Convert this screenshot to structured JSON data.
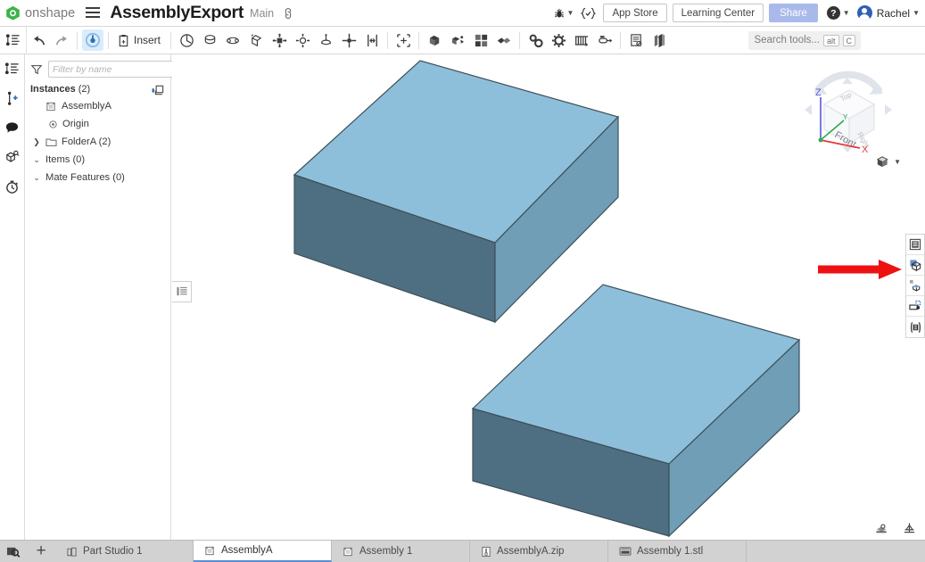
{
  "header": {
    "logo_text": "onshape",
    "logo_icon": "onshape-logo-icon",
    "menu_icon": "hamburger-menu-icon",
    "document_title": "AssemblyExport",
    "branch": "Main",
    "link_icon": "link-icon",
    "bug_icon": "bug-icon",
    "version_icon": "versions-braces-icon",
    "app_store_label": "App Store",
    "learning_center_label": "Learning Center",
    "share_label": "Share",
    "help_label": "?",
    "user_name": "Rachel"
  },
  "toolbar": {
    "tree_toggle_icon": "feature-list-icon",
    "undo_icon": "undo-arrow-icon",
    "redo_icon": "redo-arrow-icon",
    "assemble_icon": "assemble-active-icon",
    "insert_label": "Insert",
    "insert_icon": "insert-part-icon",
    "items": [
      "revolute-mate-icon",
      "cylindrical-mate-icon",
      "slider-mate-icon",
      "planar-mate-icon",
      "fastened-mate-icon",
      "ball-mate-icon",
      "pin-slot-mate-icon",
      "parallel-mate-icon",
      "tangent-mate-icon",
      "mate-connector-icon",
      "group-icon",
      "replicate-icon",
      "pattern-icon",
      "mirror-icon",
      "mate-relation-icon",
      "gear-relation-icon",
      "screw-relation-icon",
      "rack-pinion-relation-icon",
      "cam-relation-icon",
      "bill-of-materials-icon",
      "exploded-view-icon"
    ],
    "search_placeholder": "Search tools...",
    "search_key_alt": "alt",
    "search_key_c": "C"
  },
  "rail": {
    "items": [
      {
        "name": "feature-tree-icon",
        "label": "Feature list"
      },
      {
        "name": "add-version-icon",
        "label": "Versions"
      },
      {
        "name": "comments-icon",
        "label": "Comments"
      },
      {
        "name": "views-cube-icon",
        "label": "Views"
      },
      {
        "name": "history-clock-icon",
        "label": "History"
      }
    ]
  },
  "panel": {
    "filter_icon": "funnel-filter-icon",
    "filter_placeholder": "Filter by name",
    "list_options_icon": "list-options-icon",
    "instances_label": "Instances",
    "instances_count": "(2)",
    "new_folder_icon": "new-folder-icon",
    "tree": [
      {
        "label": "AssemblyA",
        "icon": "assembly-icon",
        "indent": 0,
        "chevron": ""
      },
      {
        "label": "Origin",
        "icon": "origin-icon",
        "indent": 1,
        "chevron": ""
      },
      {
        "label": "FolderA (2)",
        "icon": "folder-icon",
        "indent": 0,
        "chevron": "collapsed"
      },
      {
        "label": "Items (0)",
        "icon": "",
        "indent": 0,
        "chevron": "expanded"
      },
      {
        "label": "Mate Features (0)",
        "icon": "",
        "indent": 0,
        "chevron": "expanded"
      }
    ],
    "splitter_icon": "panel-collapse-handle-icon"
  },
  "canvas": {
    "viewcube": {
      "front_label": "Front",
      "top_label": "Top",
      "right_label": "Right",
      "axis_x": "X",
      "axis_y": "Y",
      "axis_z": "Z",
      "axis_x_color": "#ee2222",
      "axis_y_color": "#22aa44",
      "axis_z_color": "#5555dd"
    },
    "view_mode_icon": "shaded-view-icon",
    "right_toolstrip": [
      {
        "name": "display-states-icon",
        "highlighted": false
      },
      {
        "name": "export-parts-icon",
        "highlighted": true
      },
      {
        "name": "transform-copy-icon",
        "highlighted": false
      },
      {
        "name": "insert-tab-icon",
        "highlighted": false
      },
      {
        "name": "configuration-icon",
        "highlighted": false
      }
    ],
    "annotation_arrow": {
      "name": "red-pointer-arrow",
      "color": "#ee1111"
    },
    "bottom_tools": [
      {
        "name": "section-view-icon"
      },
      {
        "name": "measure-icon"
      }
    ],
    "model": {
      "face_top_color": "#8ebfda",
      "face_front_color": "#4e6f81",
      "face_right_color": "#6f9eb6",
      "edge_color": "#3d4f59",
      "boxes": 2
    }
  },
  "tabbar": {
    "zoom_icon": "zoom-to-fit-icon",
    "add_tab_icon": "plus-icon",
    "tabs": [
      {
        "label": "Part Studio 1",
        "icon": "part-studio-icon",
        "active": false
      },
      {
        "label": "AssemblyA",
        "icon": "assembly-icon",
        "active": true
      },
      {
        "label": "Assembly 1",
        "icon": "assembly-icon",
        "active": false
      },
      {
        "label": "AssemblyA.zip",
        "icon": "zip-file-icon",
        "active": false
      },
      {
        "label": "Assembly 1.stl",
        "icon": "stl-file-icon",
        "active": false
      }
    ]
  }
}
